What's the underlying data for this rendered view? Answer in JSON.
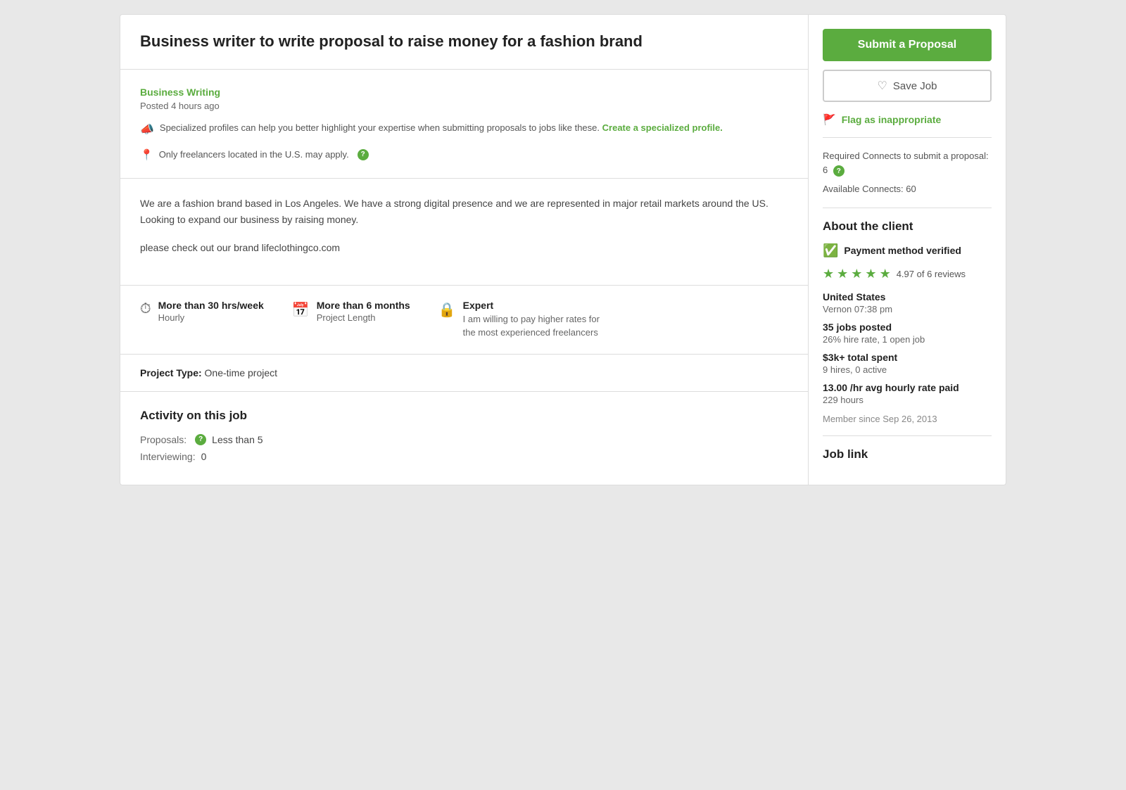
{
  "page": {
    "background": "#e8e8e8"
  },
  "header": {
    "job_title": "Business writer to write proposal to raise money for a fashion brand"
  },
  "meta": {
    "category": "Business Writing",
    "posted": "Posted 4 hours ago",
    "notice_text": "Specialized profiles can help you better highlight your expertise when submitting proposals to jobs like these.",
    "create_profile_link": "Create a specialized profile.",
    "location_notice": "Only freelancers located in the U.S. may apply."
  },
  "description": {
    "paragraph1": "We are a fashion brand based in Los Angeles.  We have a strong digital presence and we are represented in major retail markets around the US.  Looking to expand our business by raising money.",
    "paragraph2": "please check out our brand lifeclothingco.com"
  },
  "details": {
    "hours_per_week_label": "More than 30 hrs/week",
    "hours_per_week_sub": "Hourly",
    "project_length_label": "More than 6 months",
    "project_length_sub": "Project Length",
    "experience_label": "Expert",
    "experience_desc": "I am willing to pay higher rates for the most experienced freelancers"
  },
  "project_type": {
    "label": "Project Type:",
    "value": "One-time project"
  },
  "activity": {
    "title": "Activity on this job",
    "proposals_label": "Proposals:",
    "proposals_value": "Less than 5",
    "interviewing_label": "Interviewing:",
    "interviewing_value": "0"
  },
  "sidebar": {
    "submit_btn": "Submit a Proposal",
    "save_btn": "Save Job",
    "flag_label": "Flag as inappropriate",
    "connects_label": "Required Connects to submit a proposal: 6",
    "available_connects_label": "Available Connects: 60",
    "about_client_title": "About the client",
    "payment_verified": "Payment method verified",
    "rating": "4.97",
    "reviews": "4.97 of 6 reviews",
    "location_label": "United States",
    "location_time": "Vernon 07:38 pm",
    "jobs_posted_label": "35 jobs posted",
    "jobs_posted_sub": "26% hire rate, 1 open job",
    "total_spent_label": "$3k+ total spent",
    "total_spent_sub": "9 hires, 0 active",
    "avg_hourly_label": "13.00 /hr avg hourly rate paid",
    "avg_hourly_sub": "229 hours",
    "member_since": "Member since Sep 26, 2013",
    "job_link_title": "Job link"
  }
}
